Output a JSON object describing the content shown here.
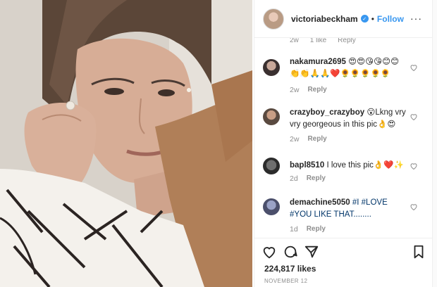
{
  "header": {
    "username": "victoriabeckham",
    "separator": "•",
    "follow_label": "Follow",
    "more_label": "···"
  },
  "partial_comment": {
    "time": "2w",
    "likes": "1 like",
    "reply": "Reply"
  },
  "comments": [
    {
      "username": "nakamura2695",
      "text": "😍😍😘😘😊😊👏👏🙏🙏❤️🌻🌻🌻🌻🌻",
      "time": "2w",
      "reply": "Reply"
    },
    {
      "username": "crazyboy_crazyboy",
      "text": "😮Lkng vry vry georgeous in this pic👌😍",
      "time": "2w",
      "reply": "Reply"
    },
    {
      "username": "bapl8510",
      "text": "I love this pic👌❤️✨",
      "time": "2d",
      "reply": "Reply"
    },
    {
      "username": "demachine5050",
      "text": "#I #LOVE #YOU LIKE THAT........",
      "time": "1d",
      "reply": "Reply"
    }
  ],
  "post": {
    "likes": "224,817 likes",
    "date": "NOVEMBER 12"
  },
  "colors": {
    "link_blue": "#3897f0",
    "hashtag": "#003569",
    "meta_gray": "#8e8e8e"
  }
}
